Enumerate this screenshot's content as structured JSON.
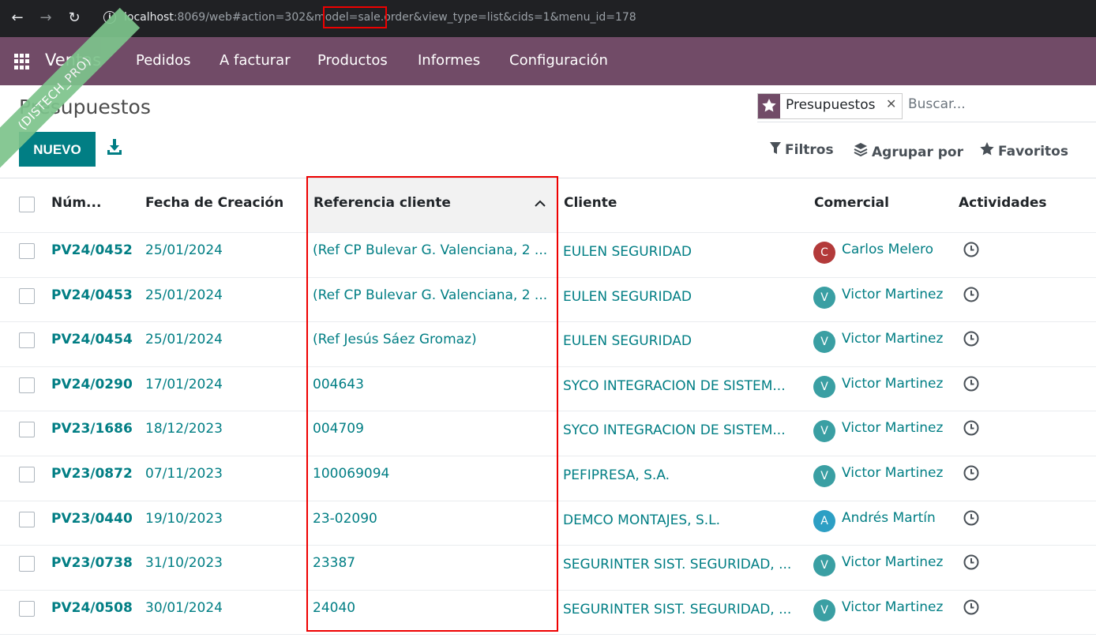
{
  "browser": {
    "url_host": "localhost",
    "url_rest": ":8069/web#action=302&model=sale.order&view_type=list&cids=1&menu_id=178"
  },
  "nav": {
    "app_name": "Ventas",
    "menu": [
      "Pedidos",
      "A facturar",
      "Productos",
      "Informes",
      "Configuración"
    ],
    "brand_color": "#714b67"
  },
  "ribbon_text": "(DISTECH_PRO)",
  "page": {
    "title": "Presupuestos",
    "new_button": "NUEVO"
  },
  "search": {
    "facet": "Presupuestos",
    "placeholder": "Buscar...",
    "filters": "Filtros",
    "group_by": "Agrupar por",
    "favorites": "Favoritos"
  },
  "table": {
    "headers": {
      "number": "Núm...",
      "date": "Fecha de Creación",
      "customer_ref": "Referencia cliente",
      "client": "Cliente",
      "salesperson": "Comercial",
      "activities": "Actividades"
    },
    "rows": [
      {
        "number": "PV24/0452",
        "date": "25/01/2024",
        "customer_ref": "(Ref CP Bulevar G. Valenciana, 2 ...",
        "client": "EULEN SEGURIDAD",
        "initial": "C",
        "avatar_color": "#b33a3a",
        "salesperson": "Carlos Melero"
      },
      {
        "number": "PV24/0453",
        "date": "25/01/2024",
        "customer_ref": "(Ref CP Bulevar G. Valenciana, 2 ...",
        "client": "EULEN SEGURIDAD",
        "initial": "V",
        "avatar_color": "#3a9fa3",
        "salesperson": "Victor Martinez"
      },
      {
        "number": "PV24/0454",
        "date": "25/01/2024",
        "customer_ref": "(Ref Jesús Sáez Gromaz)",
        "client": "EULEN SEGURIDAD",
        "initial": "V",
        "avatar_color": "#3a9fa3",
        "salesperson": "Victor Martinez"
      },
      {
        "number": "PV24/0290",
        "date": "17/01/2024",
        "customer_ref": "004643",
        "client": "SYCO INTEGRACION DE SISTEM...",
        "initial": "V",
        "avatar_color": "#3a9fa3",
        "salesperson": "Victor Martinez"
      },
      {
        "number": "PV23/1686",
        "date": "18/12/2023",
        "customer_ref": "004709",
        "client": "SYCO INTEGRACION DE SISTEM...",
        "initial": "V",
        "avatar_color": "#3a9fa3",
        "salesperson": "Victor Martinez"
      },
      {
        "number": "PV23/0872",
        "date": "07/11/2023",
        "customer_ref": "100069094",
        "client": "PEFIPRESA, S.A.",
        "initial": "V",
        "avatar_color": "#3a9fa3",
        "salesperson": "Victor Martinez"
      },
      {
        "number": "PV23/0440",
        "date": "19/10/2023",
        "customer_ref": "23-02090",
        "client": "DEMCO MONTAJES, S.L.",
        "initial": "A",
        "avatar_color": "#2d9fc4",
        "salesperson": "Andrés Martín"
      },
      {
        "number": "PV23/0738",
        "date": "31/10/2023",
        "customer_ref": "23387",
        "client": "SEGURINTER SIST. SEGURIDAD, ...",
        "initial": "V",
        "avatar_color": "#3a9fa3",
        "salesperson": "Victor Martinez"
      },
      {
        "number": "PV24/0508",
        "date": "30/01/2024",
        "customer_ref": "24040",
        "client": "SEGURINTER SIST. SEGURIDAD, ...",
        "initial": "V",
        "avatar_color": "#3a9fa3",
        "salesperson": "Victor Martinez"
      }
    ]
  }
}
